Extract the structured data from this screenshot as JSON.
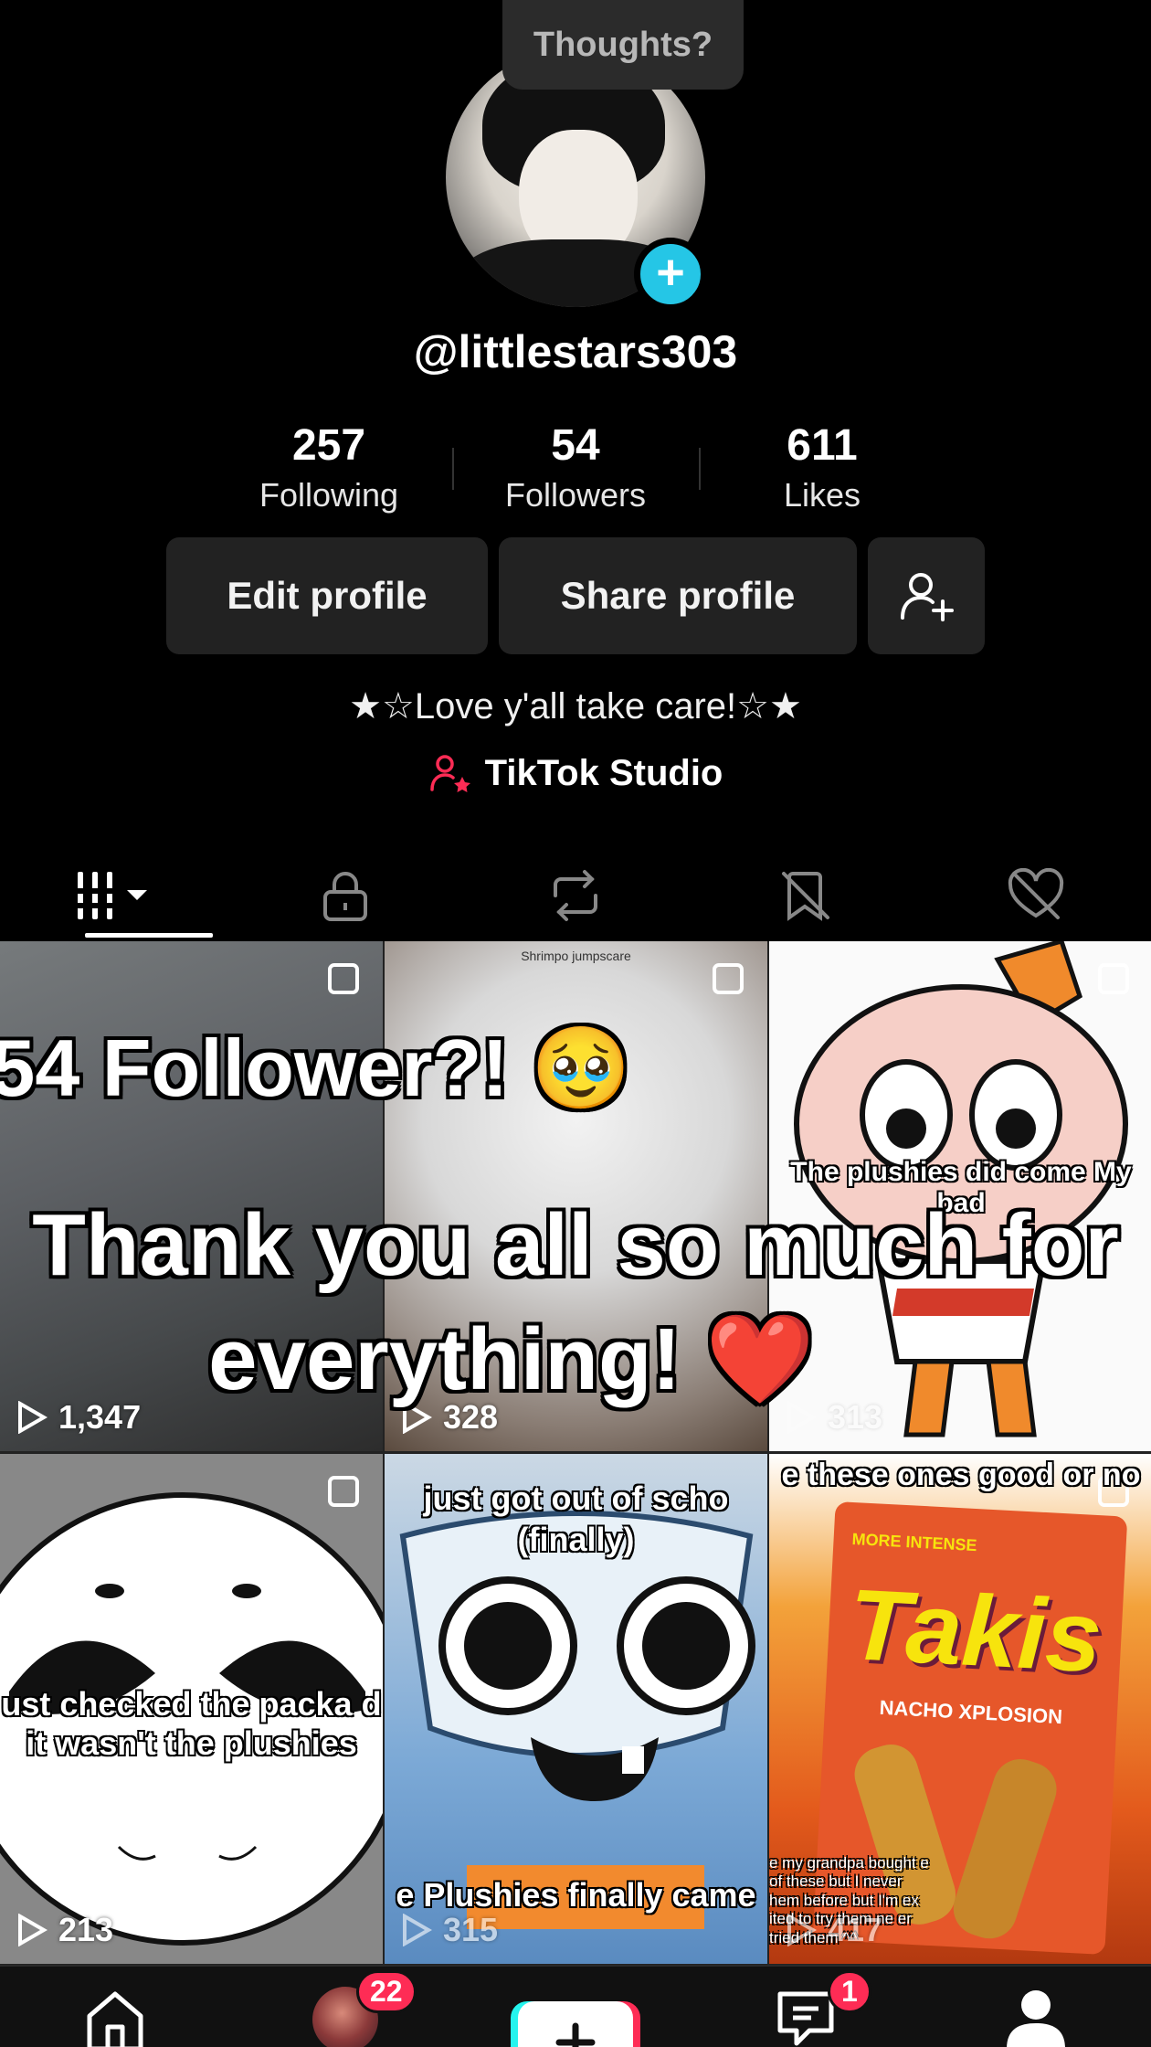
{
  "thoughts_bubble": "Thoughts?",
  "profile": {
    "username": "@littlestars303",
    "bio": "★☆Love y'all take care!☆★",
    "studio_link": "TikTok Studio"
  },
  "stats": [
    {
      "value": "257",
      "label": "Following"
    },
    {
      "value": "54",
      "label": "Followers"
    },
    {
      "value": "611",
      "label": "Likes"
    }
  ],
  "buttons": {
    "edit": "Edit profile",
    "share": "Share profile"
  },
  "tabs": [
    "videos-grid-icon",
    "lock-icon",
    "repost-icon",
    "tagged-icon",
    "liked-icon"
  ],
  "videos": [
    {
      "views": "1,347",
      "caption": ""
    },
    {
      "views": "328",
      "caption": "Shrimpo jumpscare"
    },
    {
      "views": "313",
      "caption": "The plushies did come My bad"
    },
    {
      "views": "213",
      "caption": "ust checked the packa d it wasn't the plushies"
    },
    {
      "views": "315",
      "caption": "just got out of scho (finally)",
      "caption2": "e Plushies finally came"
    },
    {
      "views": "417",
      "caption": "e these ones good or no",
      "caption2": "e my grandpa bought e of these but I never hem before but I'm ex ited to try them ne er tried them ^^"
    }
  ],
  "overlay": {
    "line1": "54 Follower?! 🥹",
    "line2": "Thank you all so much for",
    "line3": "everything! ❤️"
  },
  "takis": {
    "brand": "Takis",
    "tag": "MORE INTENSE",
    "flavor": "NACHO XPLOSION"
  },
  "navbar": {
    "inbox_badge": "22",
    "messages_badge": "1"
  },
  "colors": {
    "accent_cyan": "#25c6e6",
    "badge_red": "#fe2c55",
    "background": "#000000"
  }
}
